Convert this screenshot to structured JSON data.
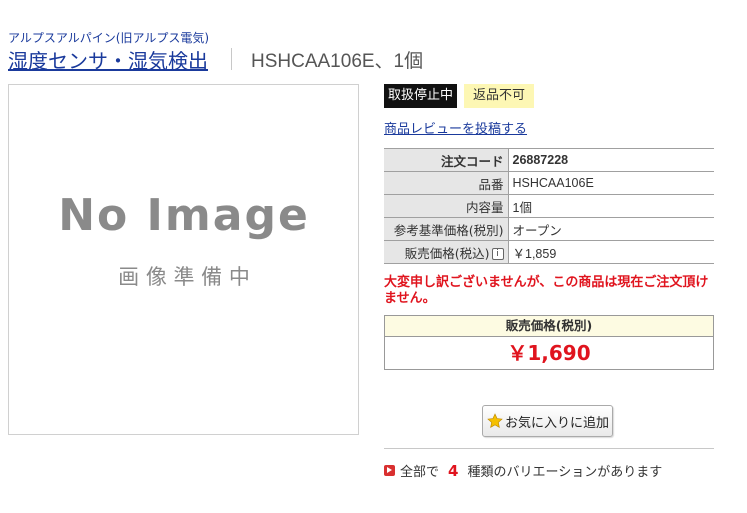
{
  "brand": "アルプスアルパイン(旧アルプス電気)",
  "product_name": "湿度センサ・湿気検出",
  "model_title": "HSHCAA106E、1個",
  "image": {
    "placeholder_text": "No Image",
    "placeholder_subtext": "画 像 準 備 中"
  },
  "badges": {
    "stopped": "取扱停止中",
    "no_return": "返品不可"
  },
  "review_link": "商品レビューを投稿する",
  "specs": [
    {
      "label": "注文コード",
      "value": "26887228"
    },
    {
      "label": "品番",
      "value": "HSHCAA106E"
    },
    {
      "label": "内容量",
      "value": "1個"
    },
    {
      "label": "参考基準価格(税別)",
      "value": "オープン"
    },
    {
      "label": "販売価格(税込)",
      "value": "￥1,859",
      "info_icon": "i"
    }
  ],
  "notice": "大変申し訳ございませんが、この商品は現在ご注文頂けません。",
  "price": {
    "label": "販売価格(税別)",
    "value": "￥1,690"
  },
  "favorite_button": "お気に入りに追加",
  "variation": {
    "prefix": "全部で",
    "count": "4",
    "suffix": "種類のバリエーションがあります"
  },
  "colors": {
    "link": "#1a3a9c",
    "alert_red": "#e0141e",
    "badge_black": "#111111",
    "badge_yellow": "#fdf7b4",
    "price_header": "#fdfbe2"
  }
}
